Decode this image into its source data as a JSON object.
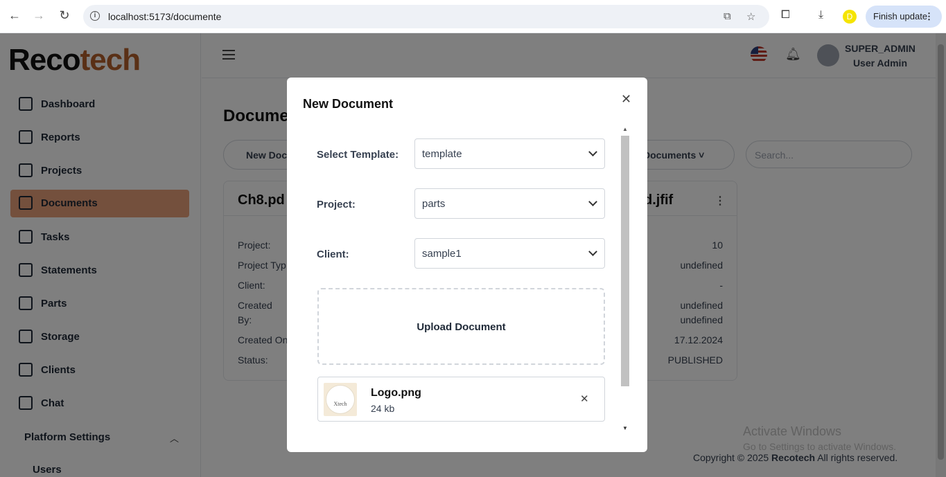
{
  "browser": {
    "url": "localhost:5173/documente",
    "finish_update": "Finish update",
    "profile_letter": "D"
  },
  "sidebar": {
    "logo_part1": "Reco",
    "logo_part2": "tech",
    "items": [
      {
        "label": "Dashboard"
      },
      {
        "label": "Reports"
      },
      {
        "label": "Projects"
      },
      {
        "label": "Documents"
      },
      {
        "label": "Tasks"
      },
      {
        "label": "Statements"
      },
      {
        "label": "Parts"
      },
      {
        "label": "Storage"
      },
      {
        "label": "Clients"
      },
      {
        "label": "Chat"
      }
    ],
    "platform_settings": "Platform Settings",
    "users": "Users"
  },
  "header": {
    "user_name": "SUPER_ADMIN",
    "user_role": "User Admin"
  },
  "page": {
    "title": "Docume",
    "new_doc_button": "New Doc",
    "documents_filter": "Documents",
    "search_placeholder": "Search...",
    "card": {
      "filename_left": "Ch8.pd",
      "filename_right": "d.jfif",
      "labels": [
        "Project:",
        "Project Typ",
        "Client:",
        "Created",
        "By:",
        "Created On",
        "Status:"
      ],
      "values": [
        "10",
        "undefined",
        "-",
        "undefined",
        "undefined",
        "17.12.2024",
        "PUBLISHED"
      ]
    },
    "footer_prefix": "Copyright © 2025 ",
    "footer_brand": "Recotech",
    "footer_suffix": " All rights reserved."
  },
  "windows_watermark": {
    "line1": "Activate Windows",
    "line2": "Go to Settings to activate Windows."
  },
  "modal": {
    "title": "New Document",
    "template_label": "Select Template:",
    "template_value": "template",
    "project_label": "Project:",
    "project_value": "parts",
    "client_label": "Client:",
    "client_value": "sample1",
    "upload_label": "Upload Document",
    "file": {
      "name": "Logo.png",
      "size": "24 kb",
      "thumb_text": "Xtech"
    }
  },
  "colors": {
    "active_item": "#e8a07a",
    "brand_orange": "#b5602d"
  }
}
